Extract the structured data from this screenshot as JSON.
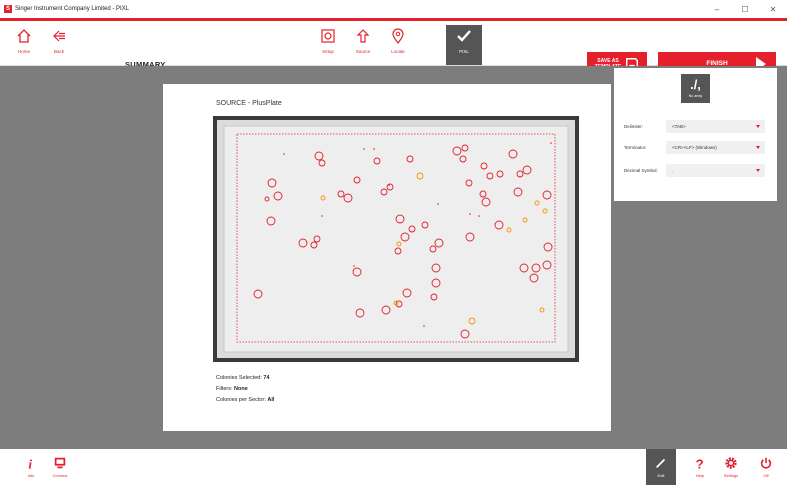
{
  "window": {
    "title": "Singer Instrument Company Limited - PIXL",
    "app_icon": "S",
    "minimize": "–",
    "maximize": "☐",
    "close": "✕"
  },
  "toolbar": {
    "home": "Home",
    "back": "Back",
    "page_title": "SUMMARY",
    "setup": "Setup",
    "source": "Source",
    "locate": "Locate",
    "pixl": "PIXL",
    "save_template": "SAVE AS\nTEMPLATE",
    "finish": "FINISH"
  },
  "document": {
    "source_title": "SOURCE -  PlusPlate",
    "colonies_label": "Colonies Selected:",
    "colonies_value": "74",
    "filters_label": "Filters:",
    "filters_value": "None",
    "sector_label": "Colonies per Sector:",
    "sector_value": "All"
  },
  "export_panel": {
    "icon_glyph": "./,",
    "icon_label": "No array",
    "delimiter_label": "Delimiter:",
    "delimiter_value": "<TAB>",
    "terminator_label": "Terminator:",
    "terminator_value": "<CR><LF> (Windows)",
    "decimal_label": "Decimal Symbol:",
    "decimal_value": "."
  },
  "footer": {
    "info": "Info",
    "connect": "Connect",
    "edit": "Edit",
    "help": "Help",
    "settings": "Settings",
    "off": "Off"
  },
  "colors": {
    "accent": "#e4202c",
    "orange": "#f39200",
    "dark": "#555555",
    "grey_bg": "#7d7d7d"
  }
}
